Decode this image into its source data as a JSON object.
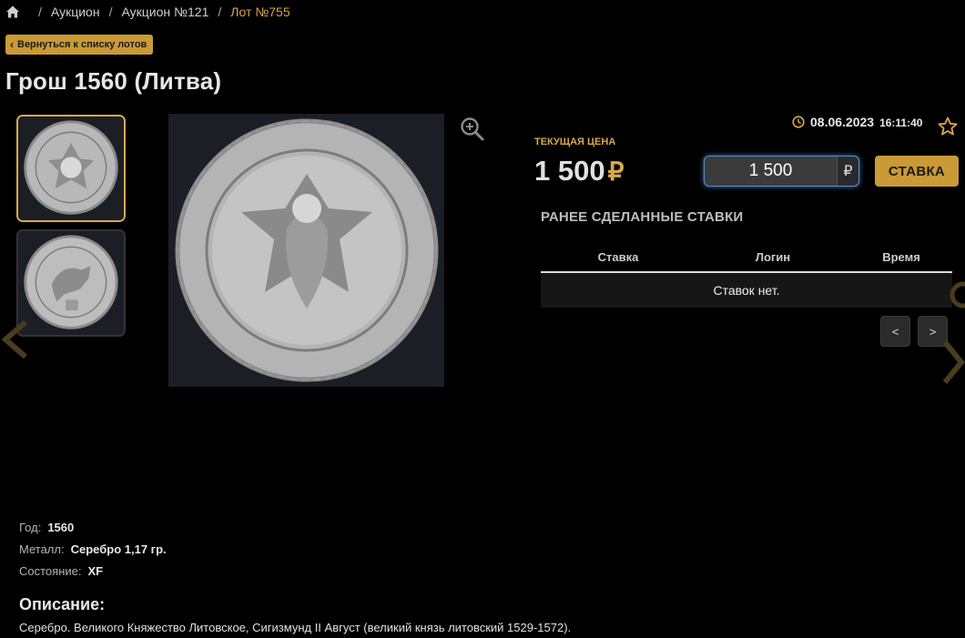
{
  "breadcrumb": {
    "home_icon": "home-icon",
    "items": [
      "Аукцион",
      "Аукцион №121",
      "Лот №755"
    ],
    "separator": "/"
  },
  "back_button": {
    "label": "Вернуться к списку лотов",
    "icon": "chevron-left-icon"
  },
  "lot": {
    "title": "Грош 1560 (Литва)"
  },
  "gallery": {
    "thumbnails": [
      "obverse",
      "reverse"
    ],
    "active_index": 0,
    "zoom_icon": "zoom-in-icon"
  },
  "auction": {
    "date": "08.06.2023",
    "time": "16:11:40",
    "clock_icon": "clock-icon",
    "favorite_icon": "star-icon",
    "price_label": "ТЕКУЩАЯ ЦЕНА",
    "price_value": "1 500",
    "currency": "₽",
    "bid_value": "1 500",
    "bid_button": "СТАВКА"
  },
  "previous_bids": {
    "title": "РАНЕЕ СДЕЛАННЫЕ СТАВКИ",
    "columns": [
      "Ставка",
      "Логин",
      "Время"
    ],
    "empty_text": "Ставок нет.",
    "prev_label": "<",
    "next_label": ">"
  },
  "specs": [
    {
      "key": "Год:",
      "value": "1560"
    },
    {
      "key": "Металл:",
      "value": "Серебро 1,17 гр."
    },
    {
      "key": "Состояние:",
      "value": "XF"
    }
  ],
  "description": {
    "title": "Описание:",
    "text": "Серебро. Великого Княжество Литовское, Сигизмунд II Август (великий князь литовский 1529-1572)."
  },
  "colors": {
    "accent": "#c99a35",
    "accent_text": "#d9a94a",
    "background": "#000000",
    "input_focus": "#5a8ec6"
  }
}
